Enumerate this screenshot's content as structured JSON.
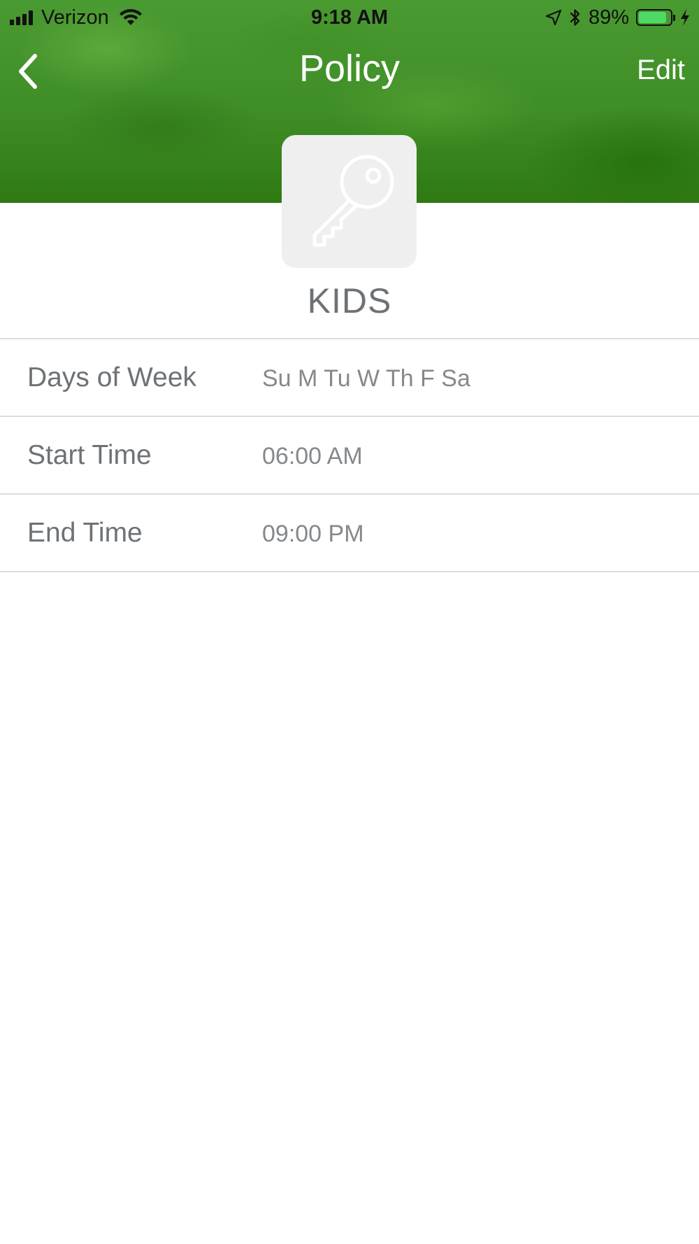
{
  "status_bar": {
    "carrier": "Verizon",
    "time": "9:18 AM",
    "battery_percent": "89%",
    "battery_level": 0.89,
    "icons": [
      "cellular-signal-icon",
      "wifi-icon",
      "location-arrow-icon",
      "bluetooth-icon",
      "battery-icon",
      "charging-bolt-icon"
    ]
  },
  "nav": {
    "back_icon": "chevron-left-icon",
    "title": "Policy",
    "edit_label": "Edit"
  },
  "policy": {
    "icon": "key-icon",
    "name": "KIDS"
  },
  "details": [
    {
      "label": "Days of Week",
      "value": "Su M Tu W Th F Sa"
    },
    {
      "label": "Start Time",
      "value": "06:00 AM"
    },
    {
      "label": "End Time",
      "value": "09:00 PM"
    }
  ],
  "colors": {
    "header_green": "#3f8d26",
    "avatar_bg": "#efefef",
    "label_text": "#6d7276",
    "value_text": "#85898c",
    "divider": "#dcdcdc",
    "battery_fill": "#4cd964"
  }
}
